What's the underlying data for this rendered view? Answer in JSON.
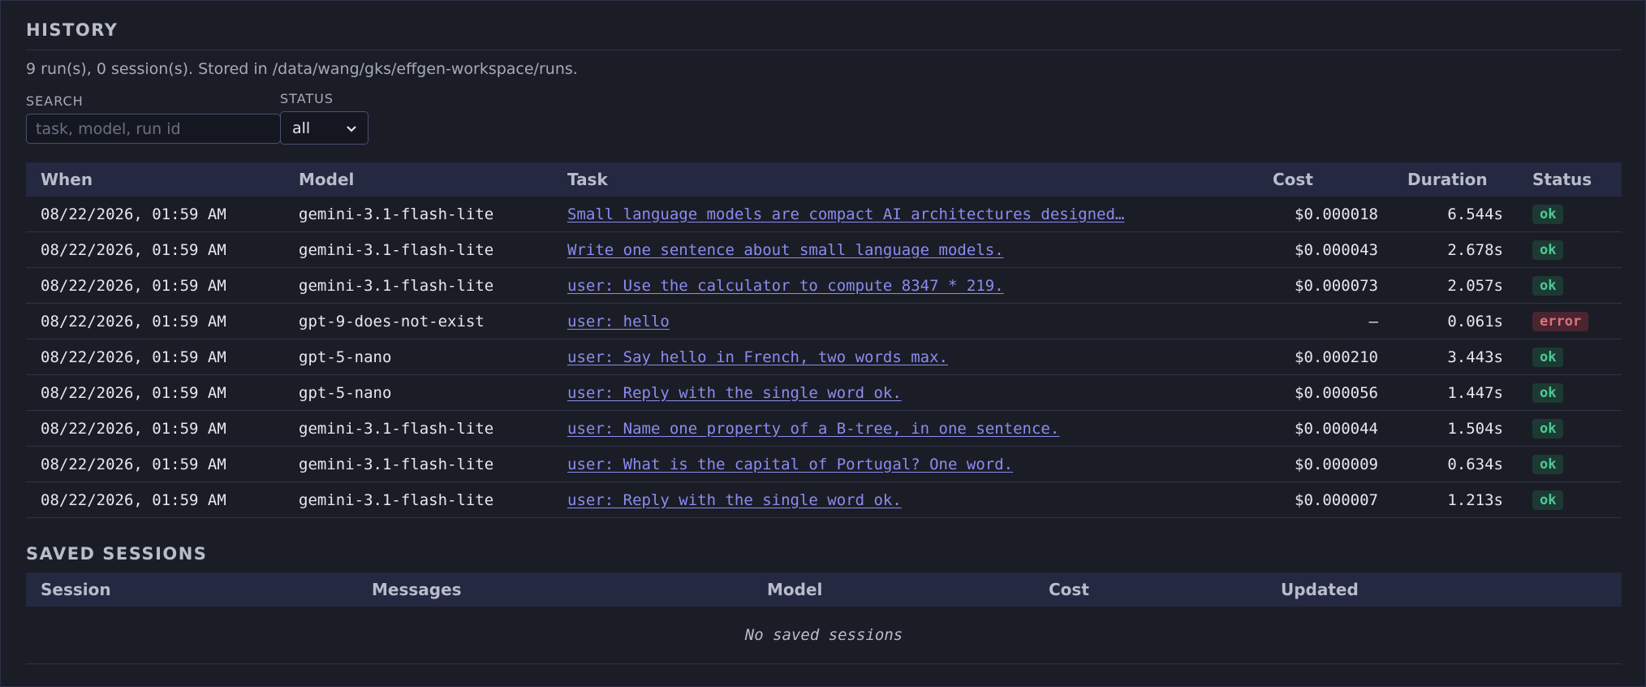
{
  "history": {
    "title": "HISTORY",
    "summary": "9 run(s), 0 session(s). Stored in /data/wang/gks/effgen-workspace/runs.",
    "search": {
      "label": "SEARCH",
      "placeholder": "task, model, run id",
      "value": ""
    },
    "status_filter": {
      "label": "STATUS",
      "selected": "all"
    },
    "columns": [
      "When",
      "Model",
      "Task",
      "Cost",
      "Duration",
      "Status"
    ],
    "rows": [
      {
        "when": "08/22/2026, 01:59 AM",
        "model": "gemini-3.1-flash-lite",
        "task": "Small language models are compact AI architectures designed…",
        "cost": "$0.000018",
        "duration": "6.544s",
        "status": "ok"
      },
      {
        "when": "08/22/2026, 01:59 AM",
        "model": "gemini-3.1-flash-lite",
        "task": "Write one sentence about small language models.",
        "cost": "$0.000043",
        "duration": "2.678s",
        "status": "ok"
      },
      {
        "when": "08/22/2026, 01:59 AM",
        "model": "gemini-3.1-flash-lite",
        "task": "user: Use the calculator to compute 8347 * 219.",
        "cost": "$0.000073",
        "duration": "2.057s",
        "status": "ok"
      },
      {
        "when": "08/22/2026, 01:59 AM",
        "model": "gpt-9-does-not-exist",
        "task": "user: hello",
        "cost": "—",
        "duration": "0.061s",
        "status": "error"
      },
      {
        "when": "08/22/2026, 01:59 AM",
        "model": "gpt-5-nano",
        "task": "user: Say hello in French, two words max.",
        "cost": "$0.000210",
        "duration": "3.443s",
        "status": "ok"
      },
      {
        "when": "08/22/2026, 01:59 AM",
        "model": "gpt-5-nano",
        "task": "user: Reply with the single word ok.",
        "cost": "$0.000056",
        "duration": "1.447s",
        "status": "ok"
      },
      {
        "when": "08/22/2026, 01:59 AM",
        "model": "gemini-3.1-flash-lite",
        "task": "user: Name one property of a B-tree, in one sentence.",
        "cost": "$0.000044",
        "duration": "1.504s",
        "status": "ok"
      },
      {
        "when": "08/22/2026, 01:59 AM",
        "model": "gemini-3.1-flash-lite",
        "task": "user: What is the capital of Portugal? One word.",
        "cost": "$0.000009",
        "duration": "0.634s",
        "status": "ok"
      },
      {
        "when": "08/22/2026, 01:59 AM",
        "model": "gemini-3.1-flash-lite",
        "task": "user: Reply with the single word ok.",
        "cost": "$0.000007",
        "duration": "1.213s",
        "status": "ok"
      }
    ]
  },
  "sessions": {
    "title": "SAVED SESSIONS",
    "columns": [
      "Session",
      "Messages",
      "Model",
      "Cost",
      "Updated"
    ],
    "empty_text": "No saved sessions"
  },
  "colors": {
    "background": "#1b1d26",
    "header_bg": "#242840",
    "link": "#8a8cf0",
    "ok": "#4ec995",
    "error": "#e0717c"
  },
  "icons": {
    "select_chevron": "chevron-down-icon"
  }
}
